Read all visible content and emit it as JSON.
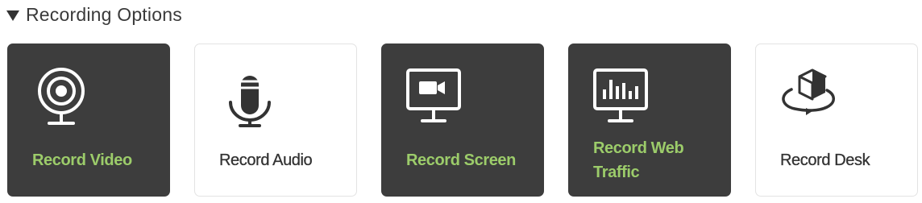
{
  "section": {
    "title": "Recording Options",
    "collapse_icon": "caret-down-icon",
    "expanded": true
  },
  "colors": {
    "card_dark_bg": "#3d3d3d",
    "card_light_bg": "#ffffff",
    "selected_label": "#9ccc6a",
    "unselected_label": "#333333"
  },
  "options": [
    {
      "label": "Record Video",
      "icon": "webcam-icon",
      "selected": true
    },
    {
      "label": "Record Audio",
      "icon": "microphone-icon",
      "selected": false
    },
    {
      "label": "Record Screen",
      "icon": "screen-recording-icon",
      "selected": true
    },
    {
      "label": "Record Web Traffic",
      "icon": "web-traffic-icon",
      "selected": true
    },
    {
      "label": "Record Desk",
      "icon": "desk-3d-icon",
      "selected": false
    }
  ]
}
